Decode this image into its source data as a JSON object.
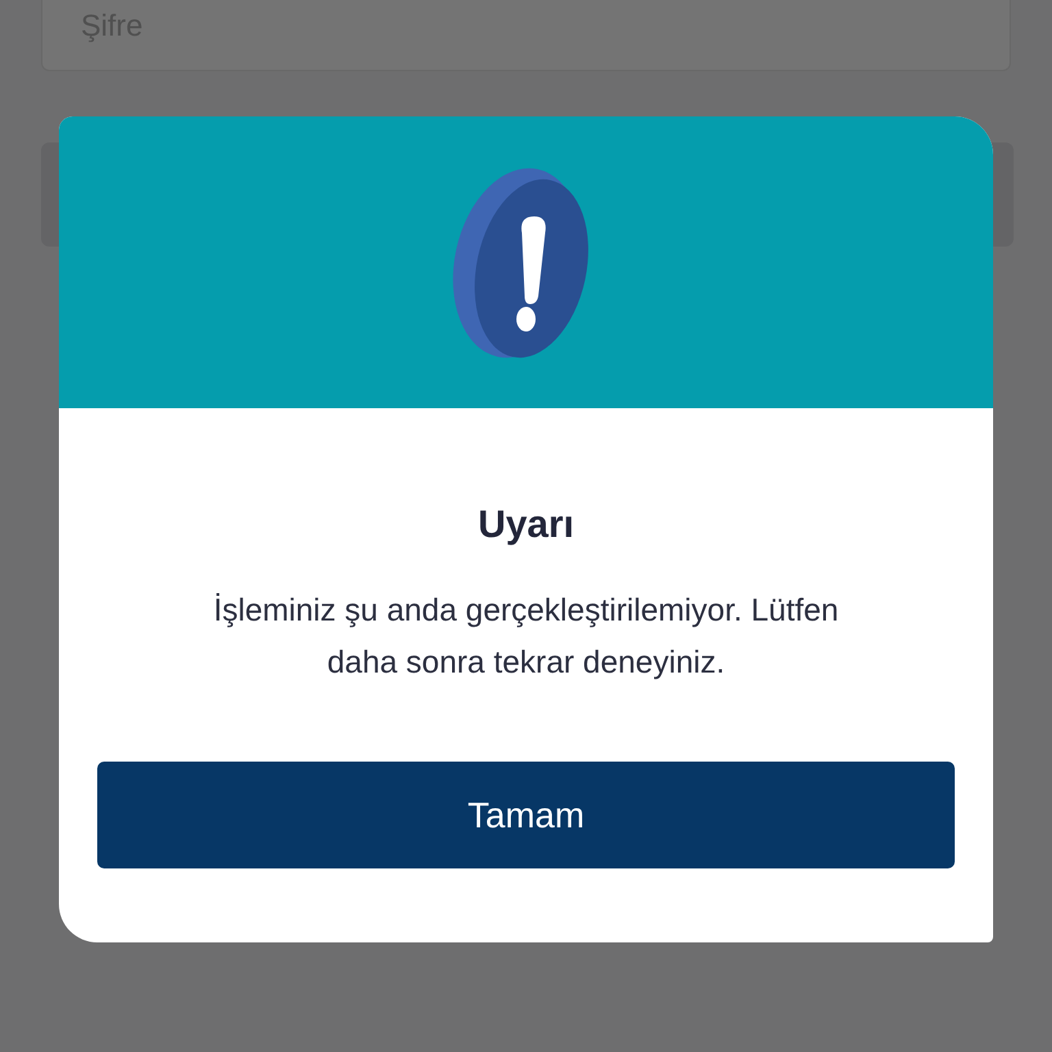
{
  "background": {
    "password_field": {
      "placeholder": "Şifre"
    }
  },
  "dialog": {
    "title": "Uyarı",
    "message": "İşleminiz şu anda gerçekleştirilemiyor. Lütfen daha sonra tekrar deneyiniz.",
    "button": "Tamam"
  }
}
